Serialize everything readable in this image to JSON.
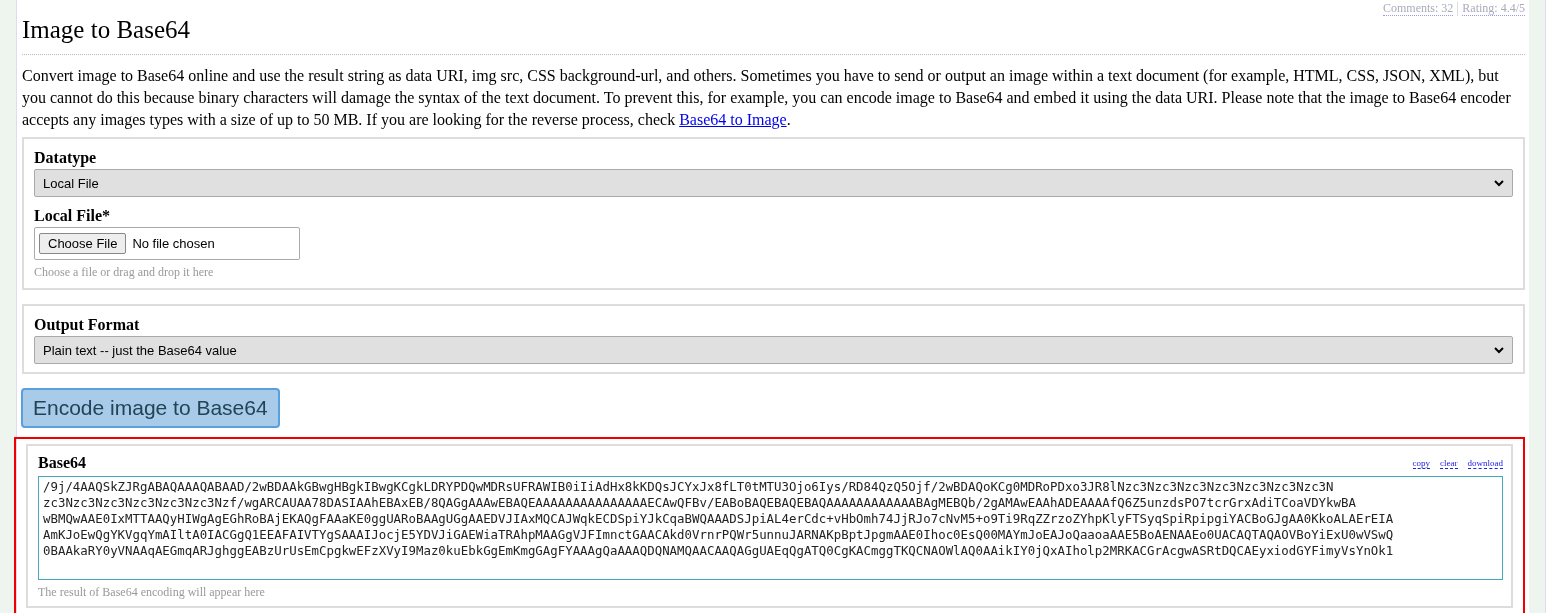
{
  "meta_links": [
    {
      "label": "Comments: 32"
    },
    {
      "label": "Rating: 4.4/5"
    }
  ],
  "title": "Image to Base64",
  "description": {
    "text": "Convert image to Base64 online and use the result string as data URI, img src, CSS background-url, and others. Sometimes you have to send or output an image within a text document (for example, HTML, CSS, JSON, XML), but you cannot do this because binary characters will damage the syntax of the text document. To prevent this, for example, you can encode image to Base64 and embed it using the data URI. Please note that the image to Base64 encoder accepts any images types with a size of up to 50 MB. If you are looking for the reverse process, check ",
    "link": "Base64 to Image",
    "tail": "."
  },
  "input_panel": {
    "datatype": {
      "label": "Datatype",
      "value": "Local File"
    },
    "file": {
      "label": "Local File*",
      "button": "Choose File",
      "status": "No file chosen",
      "hint": "Choose a file or drag and drop it here"
    }
  },
  "format_panel": {
    "label": "Output Format",
    "value": "Plain text -- just the Base64 value"
  },
  "encode_button": "Encode image to Base64",
  "result": {
    "label": "Base64",
    "actions": [
      "copy",
      "clear",
      "download"
    ],
    "lines": [
      "/9j/4AAQSkZJRgABAQAAAQABAAD/2wBDAAkGBwgHBgkIBwgKCgkLDRYPDQwMDRsUFRAWIB0iIiAdHx8kKDQsJCYxJx8fLT0tMTU3Ojo6Iys/RD84QzQ5Ojf/2wBDAQoKCg0MDRoPDxo3JR8lNzc3Nzc3Nzc3Nzc3Nzc3Nzc3Nzc3N",
      "zc3Nzc3Nzc3Nzc3Nzc3Nzc3Nzf/wgARCAUAA78DASIAAhEBAxEB/8QAGgAAAwEBAQEAAAAAAAAAAAAAAAECAwQFBv/EABoBAQEBAQEBAQAAAAAAAAAAAABAgMEBQb/2gAMAwEAAhADEAAAAfQ6Z5unzdsPO7tcrGrxAdiTCoaVDYkwBA",
      "wBMQwAAE0IxMTTAAQyHIWgAgEGhRoBAjEKAQgFAAaKE0ggUARoBAAgUGgAAEDVJIAxMQCAJWqkECDSpiYJkCqaBWQAAADSJpiAL4erCdc+vHbOmh74JjRJo7cNvM5+o9Ti9RqZZrzoZYhpKlyFTSyqSpiRpipgiYACBoGJgAA0KkoALAErEIA",
      "AmKJoEwQgYKVgqYmAIltA0IACGgQ1EEAFAIVTYgSAAAIJocjE5YDVJiGAEWiaTRAhpMAAGgVJFImnctGAACAkd0VrnrPQWr5unnuJARNAKpBptJpgmAAE0Ihoc0EsQ00MAYmJoEAJoQaaoaAAE5BoAENAAEo0UACAQTAQAOVBoYiExU0wVSwQ",
      "0BAAkaRY0yVNAAqAEGmqARJghggEABzUrUsEmCpgkwEFzXVyI9Maz0kuEbkGgEmKmgGAgFYAAAgQaAAAQDQNAMQAACAAQAGgUAEqQgATQ0CgKACmggTKQCNAOWlAQ0AAikIY0jQxAIholp2MRKACGrAcgwASRtDQCAEyxiodGYFimyVsYnOk1"
    ],
    "hint": "The result of Base64 encoding will appear here"
  }
}
